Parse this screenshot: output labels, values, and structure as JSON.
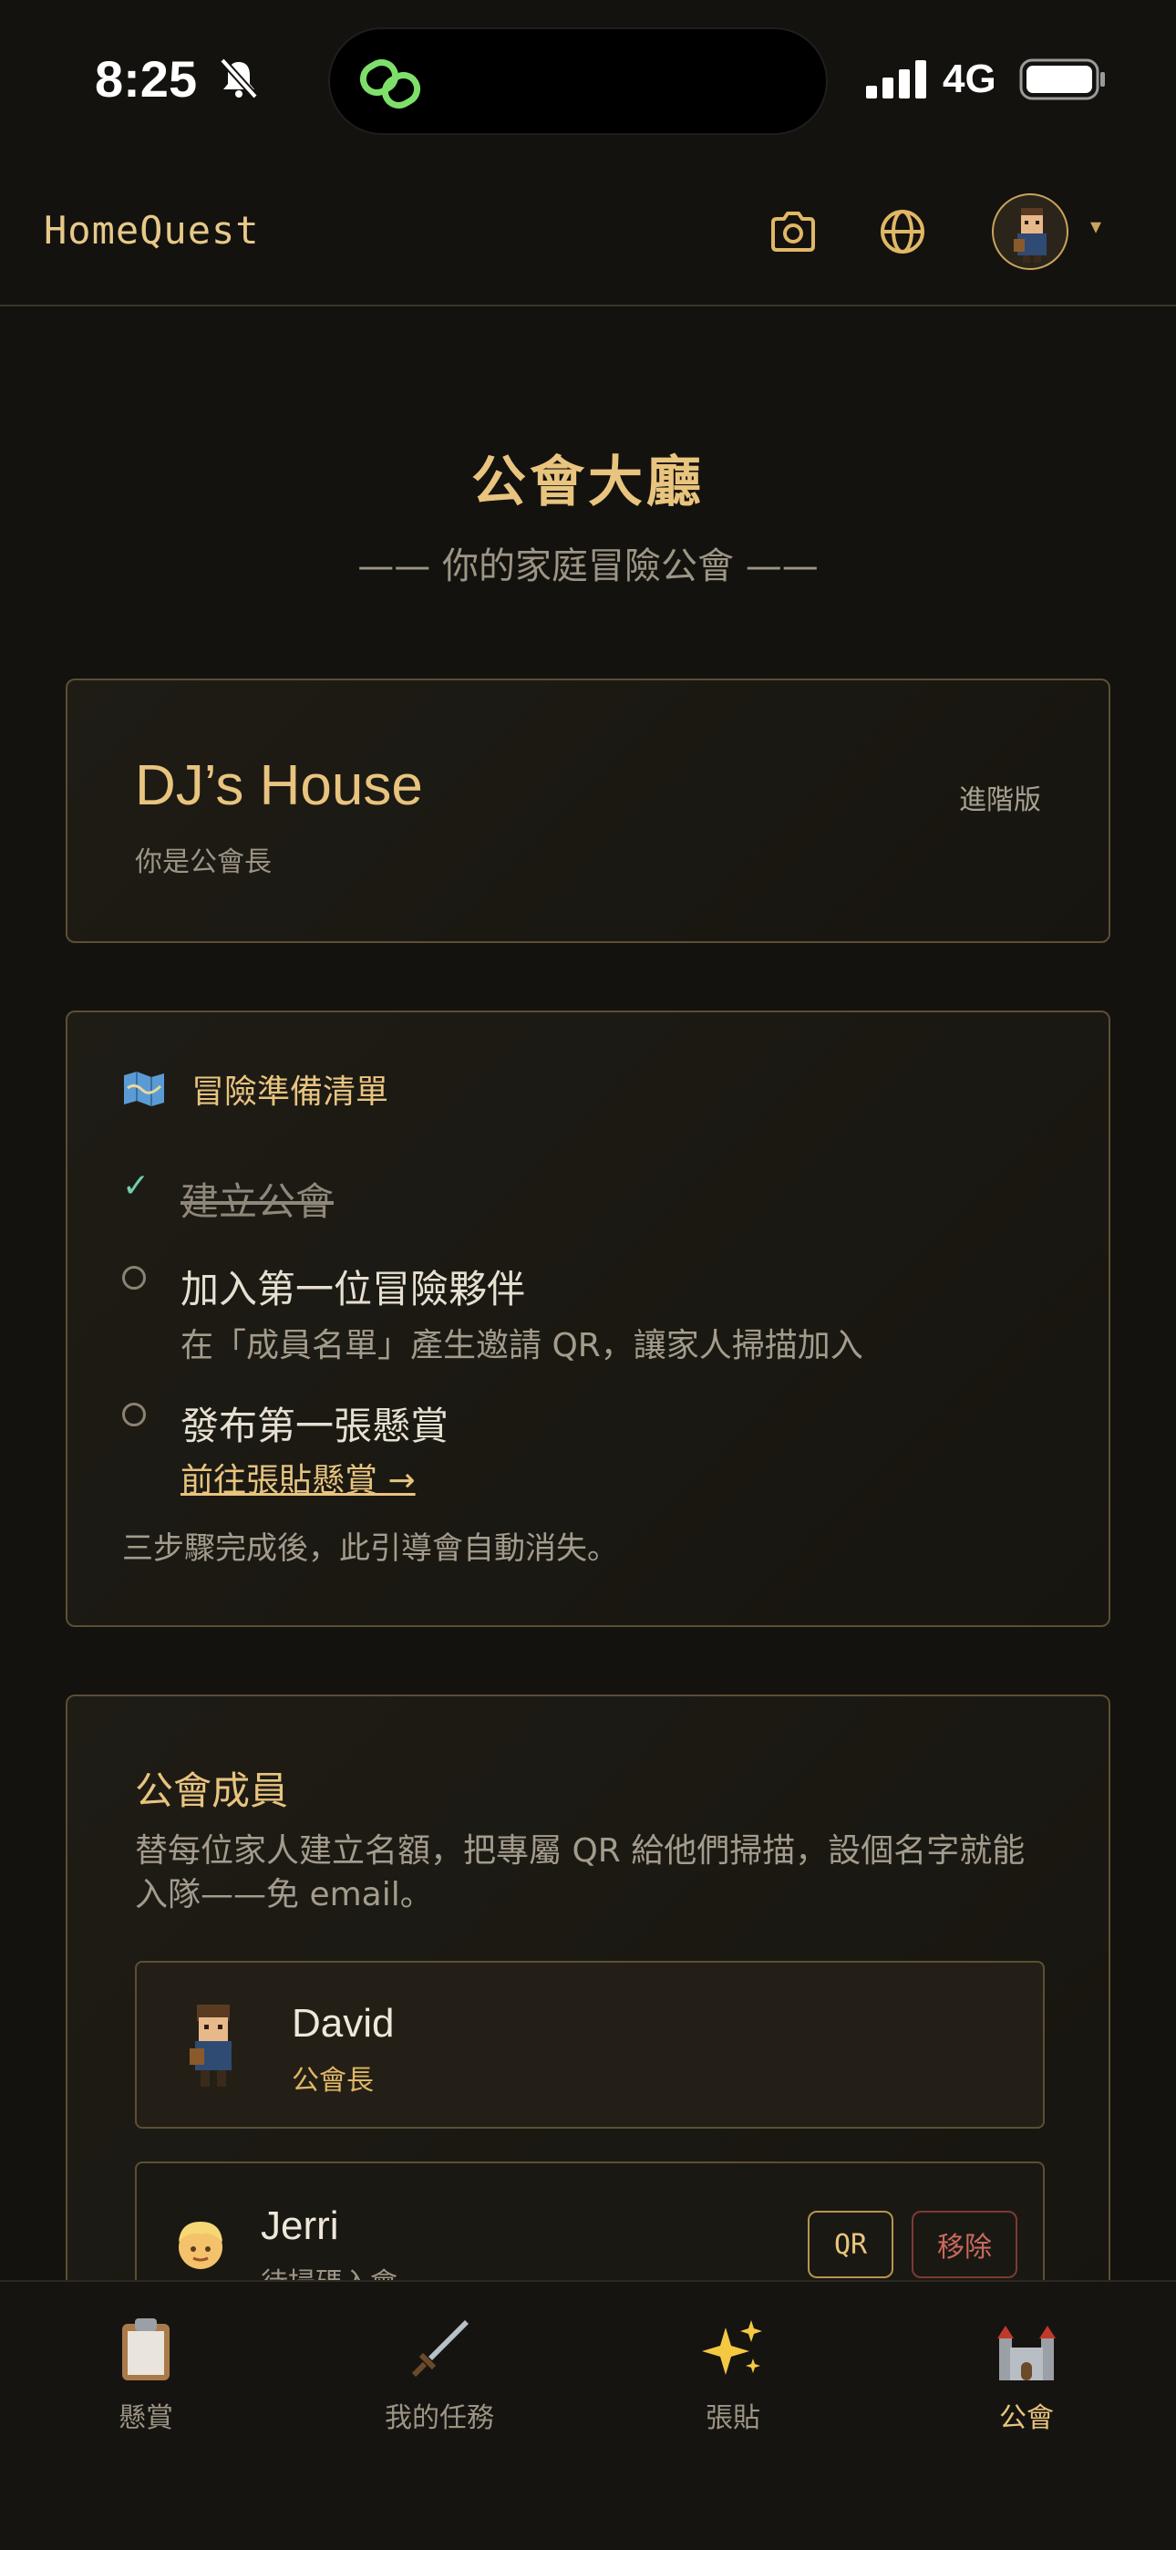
{
  "status_bar": {
    "time": "8:25",
    "network": "4G"
  },
  "header": {
    "brand": "HomeQuest",
    "caret": "▾"
  },
  "hero": {
    "title": "公會大廳",
    "subtitle": "—— 你的家庭冒險公會 ——"
  },
  "guild": {
    "name": "DJ’s House",
    "role": "你是公會長",
    "plan": "進階版"
  },
  "checklist": {
    "title": "冒險準備清單",
    "items": [
      {
        "text": "建立公會",
        "done": true
      },
      {
        "text": "加入第一位冒險夥伴",
        "hint": "在「成員名單」產生邀請 QR，讓家人掃描加入",
        "done": false
      },
      {
        "text": "發布第一張懸賞",
        "link": "前往張貼懸賞 →",
        "done": false
      }
    ],
    "footer": "三步驟完成後，此引導會自動消失。"
  },
  "members": {
    "title": "公會成員",
    "description": "替每位家人建立名額，把專屬 QR 給他們掃描，設個名字就能入隊——免 email。",
    "list": [
      {
        "name": "David",
        "role": "公會長"
      },
      {
        "name": "Jerri",
        "role": "待掃碼入會",
        "qr_label": "QR",
        "remove_label": "移除"
      }
    ]
  },
  "tabs": [
    {
      "label": "懸賞",
      "icon": "clipboard-icon",
      "active": false
    },
    {
      "label": "我的任務",
      "icon": "sword-icon",
      "active": false
    },
    {
      "label": "張貼",
      "icon": "sparkles-icon",
      "active": false
    },
    {
      "label": "公會",
      "icon": "castle-icon",
      "active": true
    }
  ],
  "colors": {
    "accent": "#e8c47e",
    "background": "#14120e",
    "success": "#6fcfa8",
    "danger": "#c86a5e"
  }
}
